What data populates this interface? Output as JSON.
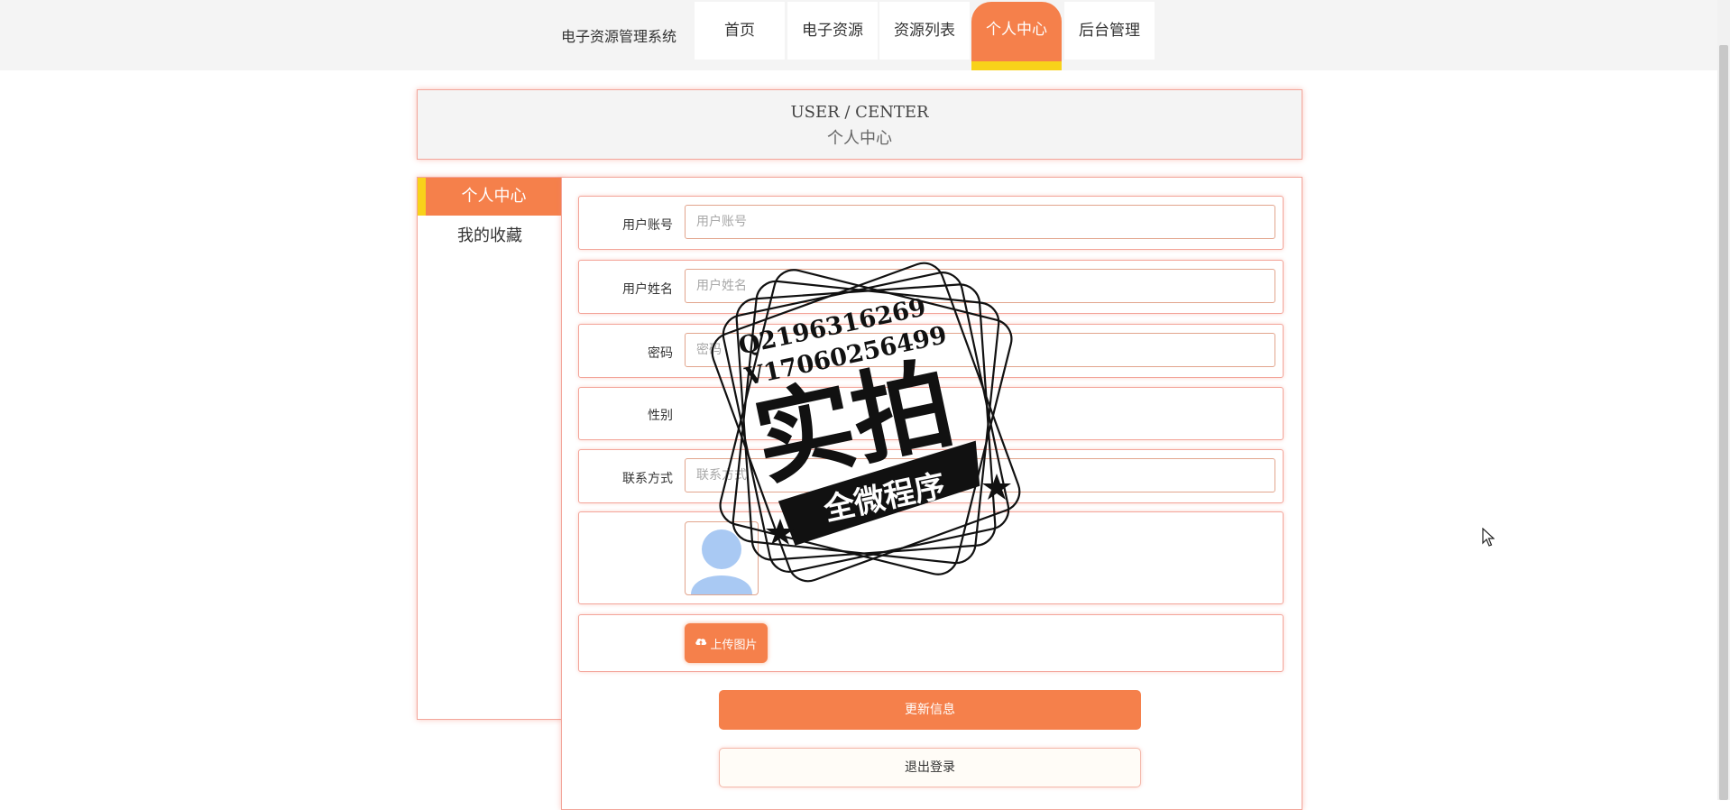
{
  "nav": {
    "site_title": "电子资源管理系统",
    "items": [
      {
        "label": "首页"
      },
      {
        "label": "电子资源"
      },
      {
        "label": "资源列表"
      },
      {
        "label": "个人中心"
      },
      {
        "label": "后台管理"
      }
    ],
    "active_index": 3
  },
  "header": {
    "en": "USER / CENTER",
    "cn": "个人中心"
  },
  "sidebar": {
    "items": [
      {
        "label": "个人中心"
      },
      {
        "label": "我的收藏"
      }
    ]
  },
  "form": {
    "account": {
      "label": "用户账号",
      "placeholder": "用户账号"
    },
    "name": {
      "label": "用户姓名",
      "placeholder": "用户姓名"
    },
    "password": {
      "label": "密码",
      "placeholder": "密码"
    },
    "gender": {
      "label": "性别"
    },
    "contact": {
      "label": "联系方式",
      "placeholder": "联系方式"
    },
    "upload_label": "上传图片",
    "update_label": "更新信息",
    "logout_label": "退出登录"
  },
  "watermark": {
    "line1": "Q2196316269",
    "line2": "V17060256499",
    "main": "实拍",
    "banner": "全微程序"
  },
  "colors": {
    "accent": "#f5804b",
    "highlight": "#f8d21a",
    "border": "#f3a59a"
  }
}
